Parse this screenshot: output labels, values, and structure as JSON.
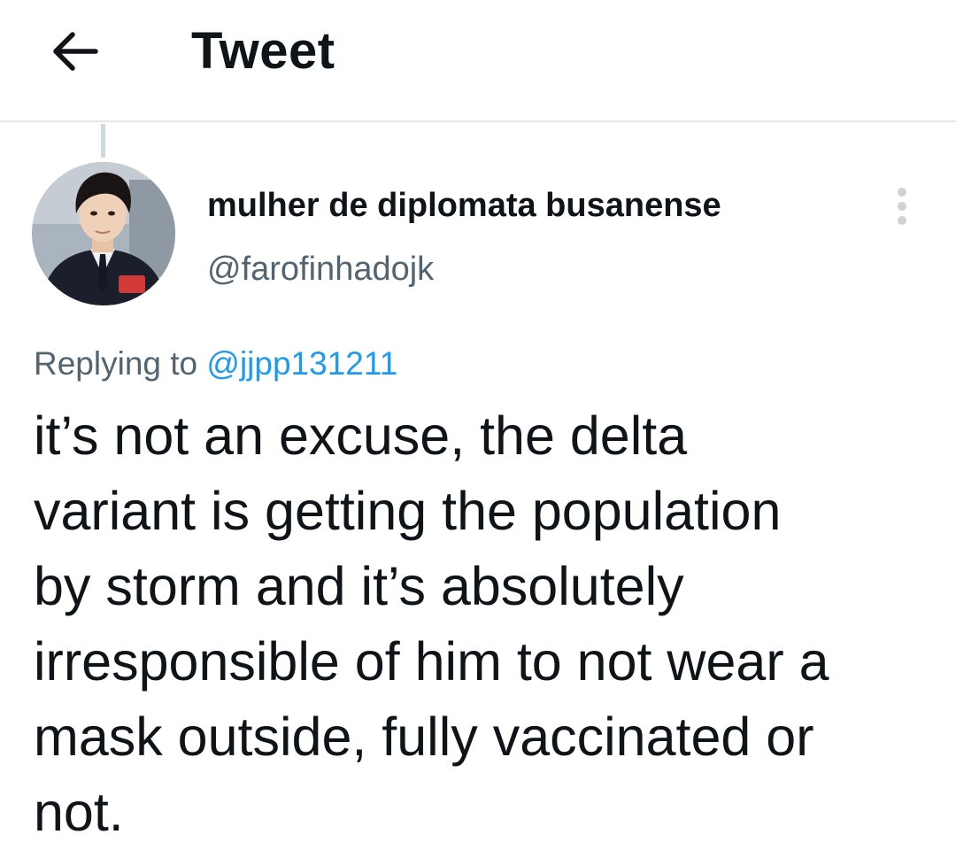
{
  "header": {
    "title": "Tweet",
    "back_icon": "arrow-left-icon"
  },
  "tweet": {
    "author": {
      "display_name": "mulher de diplomata busanense",
      "handle": "@farofinhadojk",
      "avatar_icon": "profile-photo"
    },
    "more_icon": "more-vertical-icon",
    "replying_to_label": "Replying to",
    "replying_to_handle": "@jjpp131211",
    "text": "it’s not an excuse, the delta\nvariant is getting the population\nby storm and it’s absolutely\nirresponsible of him to not wear a\nmask outside, fully vaccinated or\nnot."
  },
  "colors": {
    "text_primary": "#0f1419",
    "text_secondary": "#536471",
    "link": "#1d9bf0",
    "divider": "#e6e6e6"
  }
}
